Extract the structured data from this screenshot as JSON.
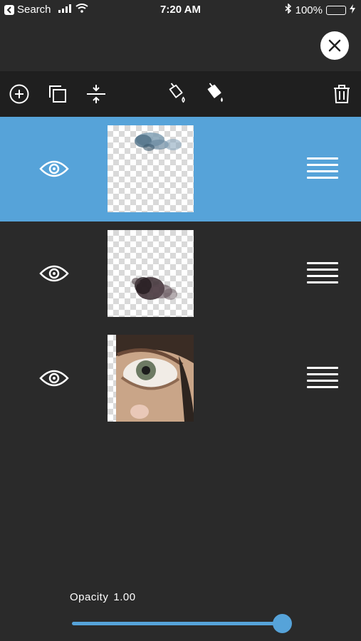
{
  "status_bar": {
    "back_label": "Search",
    "time": "7:20 AM",
    "battery_percent": "100%"
  },
  "header": {
    "close_icon": "close-icon"
  },
  "toolbar": {
    "tools": [
      "add-layer-icon",
      "duplicate-layer-icon",
      "merge-layer-icon",
      "paint-bucket-outline-icon",
      "paint-bucket-filled-icon",
      "trash-icon"
    ]
  },
  "layers": [
    {
      "visible": true,
      "selected": true,
      "content": "blue-smoke-stroke"
    },
    {
      "visible": true,
      "selected": false,
      "content": "dark-smoke-stroke"
    },
    {
      "visible": true,
      "selected": false,
      "content": "eye-photo"
    }
  ],
  "opacity": {
    "label": "Opacity",
    "value": "1.00",
    "fraction": 1.0
  },
  "colors": {
    "accent": "#56a3d9",
    "background": "#2a2a2a",
    "toolbar": "#1f1f1f"
  }
}
